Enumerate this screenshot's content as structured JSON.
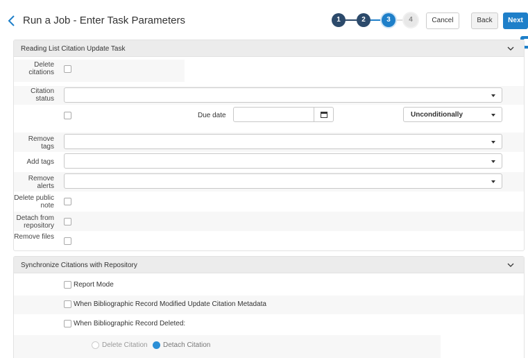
{
  "header": {
    "title": "Run a Job - Enter Task Parameters",
    "steps": [
      "1",
      "2",
      "3",
      "4"
    ],
    "cancel_label": "Cancel",
    "back_label": "Back",
    "next_label": "Next"
  },
  "colors": {
    "primary": "#1e7fc9",
    "step_done": "#2c4a6b",
    "panel_header": "#ececec"
  },
  "panel1": {
    "title": "Reading List Citation Update Task",
    "delete_citations_label": "Delete citations",
    "citation_status_label": "Citation status",
    "due_date_label": "Due date",
    "due_condition_value": "Unconditionally",
    "remove_tags_label": "Remove tags",
    "add_tags_label": "Add tags",
    "remove_alerts_label": "Remove alerts",
    "delete_public_note_label": "Delete public note",
    "detach_repository_label": "Detach from repository",
    "remove_files_label": "Remove files"
  },
  "panel2": {
    "title": "Synchronize Citations with Repository",
    "report_mode_label": "Report Mode",
    "modified_update_label": "When Bibliographic Record Modified Update Citation Metadata",
    "deleted_label": "When Bibliographic Record Deleted:",
    "delete_citation_option": "Delete Citation",
    "detach_citation_option": "Detach Citation"
  },
  "icons": {
    "back": "chevron-left-icon",
    "collapse": "chevron-down-icon",
    "calendar": "calendar-icon",
    "help": "help-tab-icon"
  }
}
